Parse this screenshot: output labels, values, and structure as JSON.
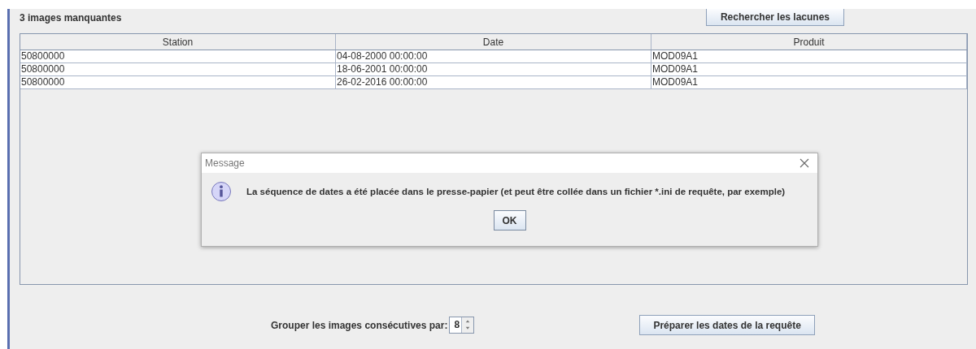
{
  "panel": {
    "title": "3 images manquantes",
    "search_button": "Rechercher les lacunes"
  },
  "table": {
    "columns": [
      "Station",
      "Date",
      "Produit"
    ],
    "rows": [
      [
        "50800000",
        "04-08-2000 00:00:00",
        "MOD09A1"
      ],
      [
        "50800000",
        "18-06-2001 00:00:00",
        "MOD09A1"
      ],
      [
        "50800000",
        "26-02-2016 00:00:00",
        "MOD09A1"
      ]
    ]
  },
  "group": {
    "label": "Grouper les images consécutives par:",
    "value": "8"
  },
  "prepare_button": "Préparer les dates de la requête",
  "dialog": {
    "title": "Message",
    "message": "La séquence de dates a été placée dans le presse-papier (et peut être collée dans un fichier *.ini de requête, par exemple)",
    "ok": "OK"
  }
}
